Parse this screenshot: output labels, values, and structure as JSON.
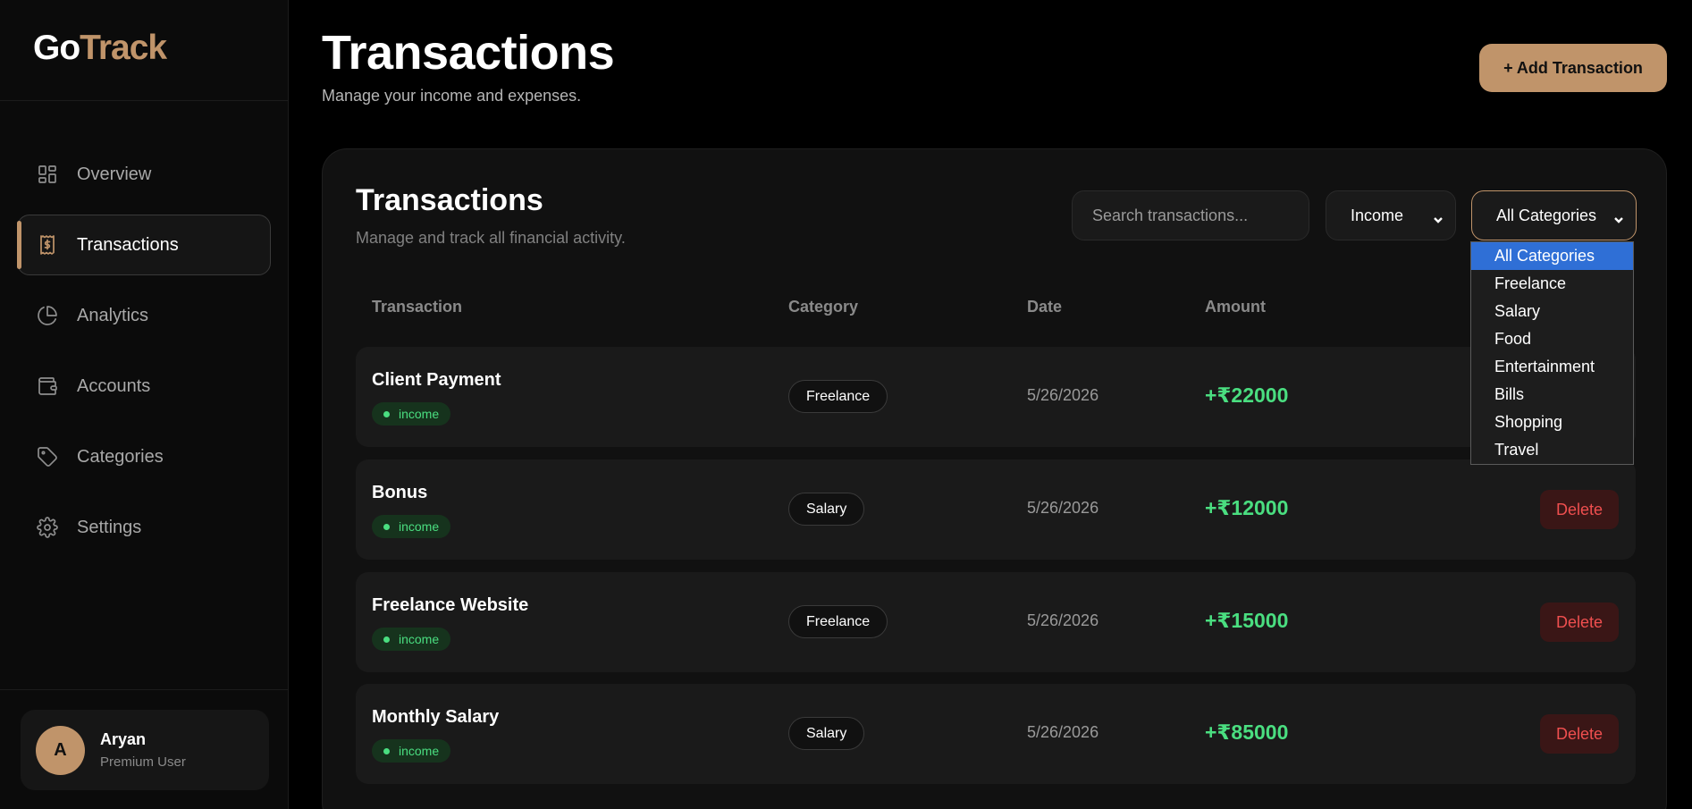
{
  "brand": {
    "part1": "Go",
    "part2": "Track"
  },
  "sidebar": {
    "items": [
      {
        "label": "Overview",
        "icon": "grid-icon",
        "active": false
      },
      {
        "label": "Transactions",
        "icon": "receipt-dollar-icon",
        "active": true
      },
      {
        "label": "Analytics",
        "icon": "pie-chart-icon",
        "active": false
      },
      {
        "label": "Accounts",
        "icon": "wallet-icon",
        "active": false
      },
      {
        "label": "Categories",
        "icon": "tag-icon",
        "active": false
      },
      {
        "label": "Settings",
        "icon": "gear-icon",
        "active": false
      }
    ]
  },
  "user": {
    "initial": "A",
    "name": "Aryan",
    "role": "Premium User"
  },
  "header": {
    "title": "Transactions",
    "subtitle": "Manage your income and expenses.",
    "add_label": "+ Add Transaction"
  },
  "card": {
    "title": "Transactions",
    "subtitle": "Manage and track all financial activity.",
    "search_placeholder": "Search transactions...",
    "type_filter": "Income",
    "category_filter": "All Categories",
    "category_options": [
      "All Categories",
      "Freelance",
      "Salary",
      "Food",
      "Entertainment",
      "Bills",
      "Shopping",
      "Travel"
    ]
  },
  "table": {
    "headers": {
      "transaction": "Transaction",
      "category": "Category",
      "date": "Date",
      "amount": "Amount"
    },
    "rows": [
      {
        "name": "Client Payment",
        "type": "income",
        "category": "Freelance",
        "date": "5/26/2026",
        "amount": "+₹22000",
        "action": "Delete"
      },
      {
        "name": "Bonus",
        "type": "income",
        "category": "Salary",
        "date": "5/26/2026",
        "amount": "+₹12000",
        "action": "Delete"
      },
      {
        "name": "Freelance Website",
        "type": "income",
        "category": "Freelance",
        "date": "5/26/2026",
        "amount": "+₹15000",
        "action": "Delete"
      },
      {
        "name": "Monthly Salary",
        "type": "income",
        "category": "Salary",
        "date": "5/26/2026",
        "amount": "+₹85000",
        "action": "Delete"
      }
    ]
  },
  "colors": {
    "accent": "#c0946a",
    "income": "#4ade80",
    "danger": "#ef4f4f",
    "selected_option": "#2f6fd6"
  }
}
